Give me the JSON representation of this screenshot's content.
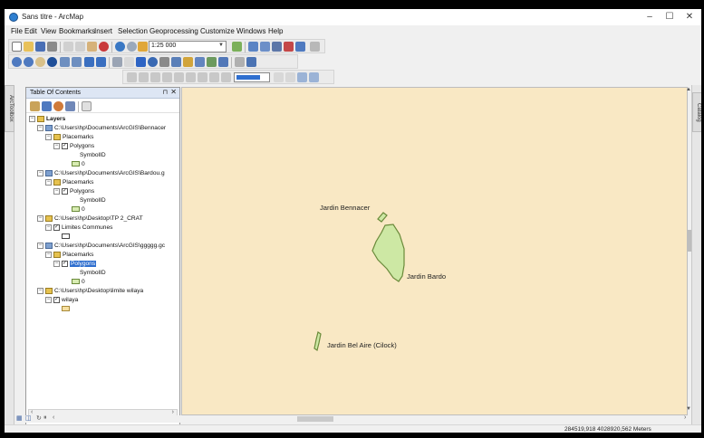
{
  "window": {
    "title": "Sans titre - ArcMap",
    "minimize": "–",
    "maximize": "☐",
    "close": "✕"
  },
  "menu": [
    "File",
    "Edit",
    "View",
    "Bookmarks",
    "Insert",
    "Selection",
    "Geoprocessing",
    "Customize",
    "Windows",
    "Help"
  ],
  "toolbar": {
    "scale": "1:25 000"
  },
  "side_tabs": {
    "left": "ArcToolbox",
    "right": "Catalog"
  },
  "toc": {
    "title": "Table Of Contents",
    "pin": "⊓",
    "close": "✕",
    "root": "Layers",
    "groups": [
      {
        "path": "C:\\Users\\hp\\Documents\\ArcGIS\\Bennacer",
        "kind": "kml",
        "sub": "Placemarks",
        "layer": "Polygons",
        "field": "SymbolID",
        "value": "0"
      },
      {
        "path": "C:\\Users\\hp\\Documents\\ArcGIS\\Bardou.g",
        "kind": "kml",
        "sub": "Placemarks",
        "layer": "Polygons",
        "field": "SymbolID",
        "value": "0"
      },
      {
        "path": "C:\\Users\\hp\\Desktop\\TP 2_CRAT",
        "kind": "folder",
        "layer": "Limites Communes"
      },
      {
        "path": "C:\\Users\\hp\\Documents\\ArcGIS\\ggggg.gc",
        "kind": "kml",
        "sub": "Placemarks",
        "layer": "Polygons",
        "field": "SymbolID",
        "value": "0",
        "selected": true
      },
      {
        "path": "C:\\Users\\hp\\Desktop\\limite wilaya",
        "kind": "folder",
        "layer": "wilaya"
      }
    ]
  },
  "map": {
    "labels": {
      "bennacer": "Jardin Bennacer",
      "bardo": "Jardin Bardo",
      "belaire": "Jardin Bel Aire (Cilock)"
    },
    "colors": {
      "background": "#f9e8c4",
      "polygon_fill": "#cde8a4",
      "polygon_stroke": "#6a8a3a"
    }
  },
  "status": {
    "coords": "284519,918 4028920,562 Meters"
  }
}
